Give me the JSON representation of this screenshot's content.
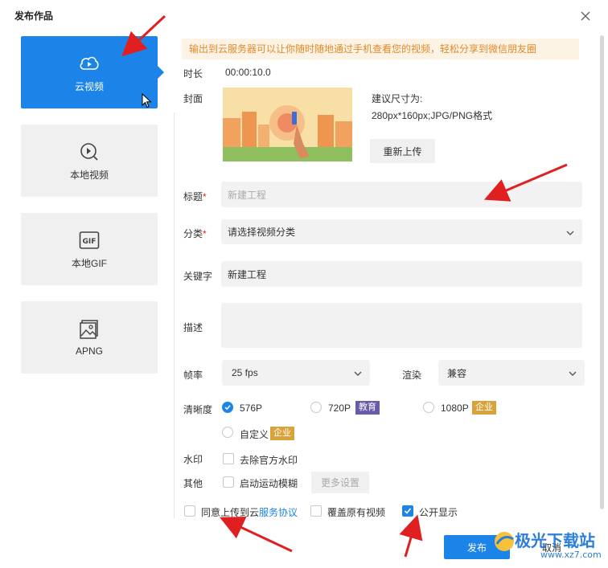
{
  "dialog": {
    "title": "发布作品"
  },
  "tabs": [
    {
      "label": "云视频",
      "icon": "cloud-play-icon",
      "active": true
    },
    {
      "label": "本地视频",
      "icon": "search-play-icon"
    },
    {
      "label": "本地GIF",
      "icon": "gif-icon"
    },
    {
      "label": "APNG",
      "icon": "image-icon"
    }
  ],
  "notice": "输出到云服务器可以让你随时随地通过手机查看您的视频，轻松分享到微信朋友圈",
  "form": {
    "duration_label": "时长",
    "duration_value": "00:00:10.0",
    "cover_label": "封面",
    "cover_hint_line1": "建议尺寸为:",
    "cover_hint_line2": "280px*160px;JPG/PNG格式",
    "reupload_label": "重新上传",
    "title_label": "标题",
    "title_placeholder": "新建工程",
    "category_label": "分类",
    "category_value": "请选择视频分类",
    "keyword_label": "关键字",
    "keyword_value": "新建工程",
    "desc_label": "描述",
    "desc_value": "",
    "fps_label": "帧率",
    "fps_value": "25 fps",
    "render_label": "渲染",
    "render_value": "兼容",
    "clarity_label": "清晰度",
    "clarity_options": [
      {
        "label": "576P",
        "selected": true,
        "badge": ""
      },
      {
        "label": "720P",
        "selected": false,
        "badge": "教育"
      },
      {
        "label": "1080P",
        "selected": false,
        "badge": "企业"
      },
      {
        "label": "自定义",
        "selected": false,
        "badge": "企业"
      }
    ],
    "watermark_label": "水印",
    "watermark_option": "去除官方水印",
    "other_label": "其他",
    "motion_blur_option": "启动运动模糊",
    "more_settings_label": "更多设置"
  },
  "footer": {
    "agree_text": "同意上传到云",
    "agree_link": "服务协议",
    "overwrite_text": "覆盖原有视频",
    "public_text": "公开显示",
    "public_checked": true,
    "publish_label": "发布",
    "cancel_label": "取消"
  },
  "watermark_site": {
    "name": "极光下载站",
    "url": "www.xz7.com"
  },
  "colors": {
    "accent": "#1c84e8",
    "notice_bg": "#fdf3e4",
    "notice_text": "#e08a2c",
    "arrow": "#e02020"
  }
}
